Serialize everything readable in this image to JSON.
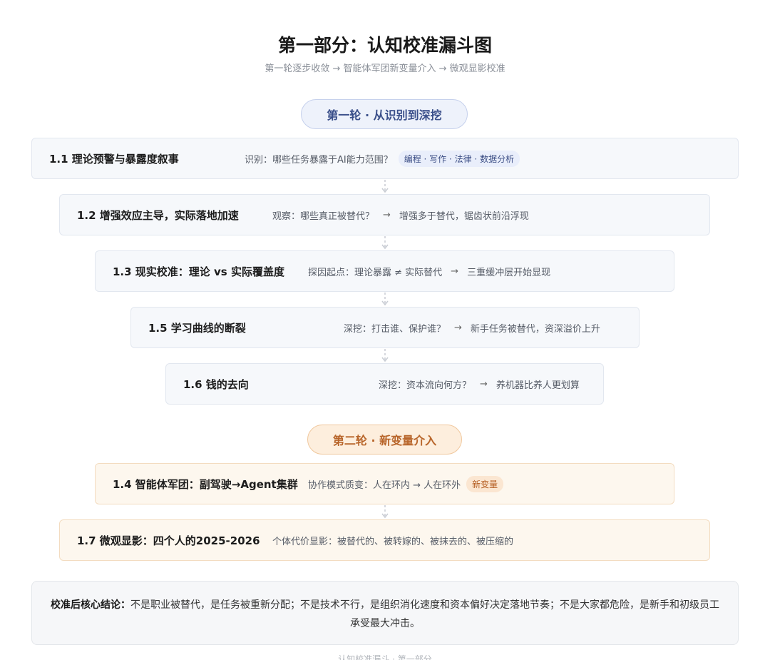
{
  "header": {
    "title": "第一部分：认知校准漏斗图",
    "subtitle": "第一轮逐步收敛 → 智能体军团新变量介入 → 微观显影校准"
  },
  "round1": {
    "label": "第一轮 · 从识别到深挖",
    "rows": [
      {
        "title": "1.1 理论预警与暴露度叙事",
        "desc": "识别：哪些任务暴露于AI能力范围？",
        "tag": "编程 · 写作 · 法律 · 数据分析"
      },
      {
        "title": "1.2 增强效应主导，实际落地加速",
        "desc": "观察：哪些真正被替代？",
        "arrow": "→",
        "result": "增强多于替代，锯齿状前沿浮现"
      },
      {
        "title": "1.3 现实校准：理论 vs 实际覆盖度",
        "desc": "探因起点：理论暴露 ≠ 实际替代",
        "arrow": "→",
        "result": "三重缓冲层开始显现"
      },
      {
        "title": "1.5 学习曲线的断裂",
        "desc": "深挖：打击谁、保护谁？",
        "arrow": "→",
        "result": "新手任务被替代，资深溢价上升"
      },
      {
        "title": "1.6 钱的去向",
        "desc": "深挖：资本流向何方？",
        "arrow": "→",
        "result": "养机器比养人更划算"
      }
    ]
  },
  "round2": {
    "label": "第二轮 · 新变量介入",
    "rows": [
      {
        "title": "1.4 智能体军团：副驾驶→Agent集群",
        "desc": "协作模式质变：人在环内 → 人在环外",
        "tag": "新变量"
      },
      {
        "title": "1.7 微观显影：四个人的2025-2026",
        "desc": "个体代价显影：被替代的、被转嫁的、被抹去的、被压缩的"
      }
    ]
  },
  "conclusion": {
    "label": "校准后核心结论：",
    "text": "不是职业被替代，是任务被重新分配；不是技术不行，是组织消化速度和资本偏好决定落地节奏；不是大家都危险，是新手和初级员工承受最大冲击。"
  },
  "footer": {
    "text": "认知校准漏斗 · 第一部分"
  },
  "colors": {
    "round1_accent": "#3a4f8a",
    "round2_accent": "#b8652a"
  }
}
